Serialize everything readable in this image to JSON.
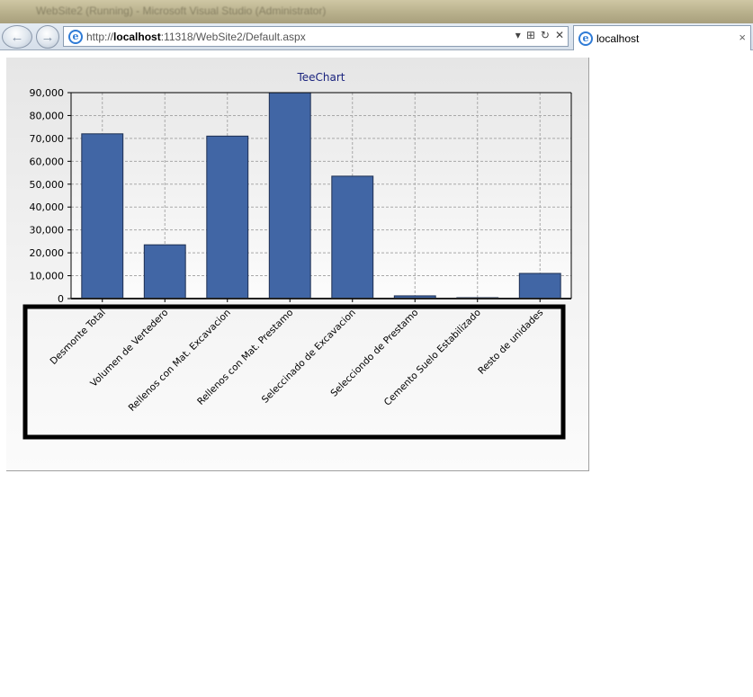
{
  "browser": {
    "window_title": "WebSite2 (Running) - Microsoft Visual Studio (Administrator)",
    "address_prefix": "http://",
    "address_host": "localhost",
    "address_rest": ":11318/WebSite2/Default.aspx",
    "tab_title": "localhost",
    "tab_close": "×",
    "tool_icons": [
      "compat-view-icon",
      "refresh-icon",
      "stop-icon"
    ],
    "stop_glyph": "✕",
    "refresh_glyph": "↻",
    "compat_glyph": "⊞",
    "dropdown_glyph": "▾"
  },
  "chart_data": {
    "type": "bar",
    "title": "TeeChart",
    "categories": [
      "Desmonte Total",
      "Volumen de Vertedero",
      "Rellenos con Mat. Excavacion",
      "Rellenos con Mat. Prestamo",
      "Seleccinado de Excavacion",
      "Selecciondo de Prestamo",
      "Cemento Suelo Estabilizado",
      "Resto de unidades"
    ],
    "values": [
      72000,
      23500,
      71000,
      92000,
      53500,
      1200,
      300,
      11000
    ],
    "ylim": [
      0,
      90000
    ],
    "yticks": [
      "0",
      "10,000",
      "20,000",
      "30,000",
      "40,000",
      "50,000",
      "60,000",
      "70,000",
      "80,000",
      "90,000"
    ],
    "grid": true,
    "bar_color": "#4166a5",
    "title_color": "#1a237e"
  }
}
